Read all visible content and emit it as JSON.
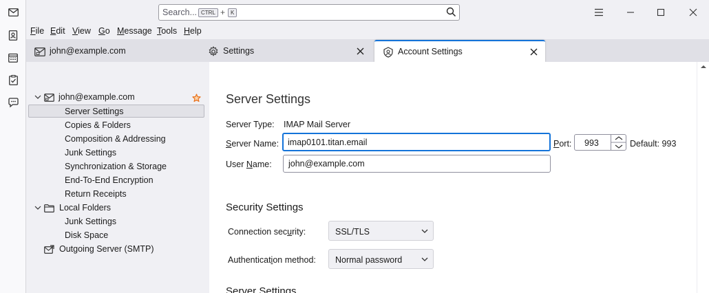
{
  "spaces": {
    "items": [
      {
        "icon": "mail-icon"
      },
      {
        "icon": "address-book-icon"
      },
      {
        "icon": "calendar-icon"
      },
      {
        "icon": "tasks-icon"
      },
      {
        "icon": "chat-icon"
      }
    ]
  },
  "titlebar": {
    "search_placeholder": "Search...",
    "shortcut_key1": "CTRL",
    "shortcut_plus": "+",
    "shortcut_key2": "K"
  },
  "menubar": {
    "items": [
      {
        "label": "File"
      },
      {
        "label": "Edit"
      },
      {
        "label": "View"
      },
      {
        "label": "Go"
      },
      {
        "label": "Message"
      },
      {
        "label": "Tools"
      },
      {
        "label": "Help"
      }
    ]
  },
  "tabs": [
    {
      "label": "john@example.com",
      "icon": "mail-tab-icon",
      "active": false
    },
    {
      "label": "Settings",
      "icon": "gear-icon",
      "active": false
    },
    {
      "label": "Account Settings",
      "icon": "account-icon",
      "active": true
    }
  ],
  "tree": {
    "account": "john@example.com",
    "account_items": [
      "Server Settings",
      "Copies & Folders",
      "Composition & Addressing",
      "Junk Settings",
      "Synchronization & Storage",
      "End-To-End Encryption",
      "Return Receipts"
    ],
    "local_folders": "Local Folders",
    "local_items": [
      "Junk Settings",
      "Disk Space"
    ],
    "outgoing": "Outgoing Server (SMTP)"
  },
  "content": {
    "title": "Server Settings",
    "server_type_label": "Server Type:",
    "server_type_value": "IMAP Mail Server",
    "server_name_label": "Server Name:",
    "server_name_value": "imap0101.titan.email",
    "port_label": "Port:",
    "port_value": "993",
    "default_label": "Default: 993",
    "user_name_label": "User Name:",
    "user_name_value": "john@example.com",
    "security_title": "Security Settings",
    "connection_security_label": "Connection security:",
    "connection_security_value": "SSL/TLS",
    "auth_method_label": "Authentication method:",
    "auth_method_value": "Normal password",
    "server_settings_title2": "Server Settings"
  },
  "colors": {
    "accent": "#1373d9",
    "star": "#e8711c"
  }
}
